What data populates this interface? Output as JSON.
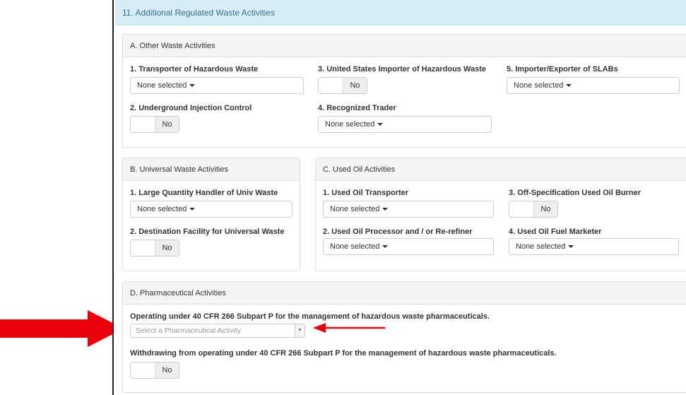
{
  "section_title": "11. Additional Regulated Waste Activities",
  "other_waste": {
    "heading": "A. Other Waste Activities",
    "transporter": {
      "label": "1. Transporter of Hazardous Waste",
      "value": "None selected"
    },
    "underground": {
      "label": "2. Underground Injection Control",
      "value": "No"
    },
    "us_importer": {
      "label": "3. United States Importer of Hazardous Waste",
      "value": "No"
    },
    "recognized_trader": {
      "label": "4. Recognized Trader",
      "value": "None selected"
    },
    "slabs": {
      "label": "5. Importer/Exporter of SLABs",
      "value": "None selected"
    }
  },
  "universal_waste": {
    "heading": "B. Universal Waste Activities",
    "large_quantity": {
      "label": "1. Large Quantity Handler of Univ Waste",
      "value": "None selected"
    },
    "destination": {
      "label": "2. Destination Facility for Universal Waste",
      "value": "No"
    }
  },
  "used_oil": {
    "heading": "C. Used Oil Activities",
    "transporter": {
      "label": "1. Used Oil Transporter",
      "value": "None selected"
    },
    "processor": {
      "label": "2. Used Oil Processor and / or Re-refiner",
      "value": "None selected"
    },
    "burner": {
      "label": "3. Off-Specification Used Oil Burner",
      "value": "No"
    },
    "marketer": {
      "label": "4. Used Oil Fuel Marketer",
      "value": "None selected"
    }
  },
  "pharma": {
    "heading": "D. Pharmaceutical Activities",
    "operating_label": "Operating under 40 CFR 266 Subpart P for the management of hazardous waste pharmaceuticals.",
    "select_placeholder": "Select a Pharmaceutical Activity",
    "withdrawing_label": "Withdrawing from operating under 40 CFR 266 Subpart P for the management of hazardous waste pharmaceuticals.",
    "withdrawing_value": "No"
  },
  "colors": {
    "annotation_arrow": "#e8000b",
    "heading_bg": "#d9edf7",
    "heading_text": "#31708f"
  }
}
